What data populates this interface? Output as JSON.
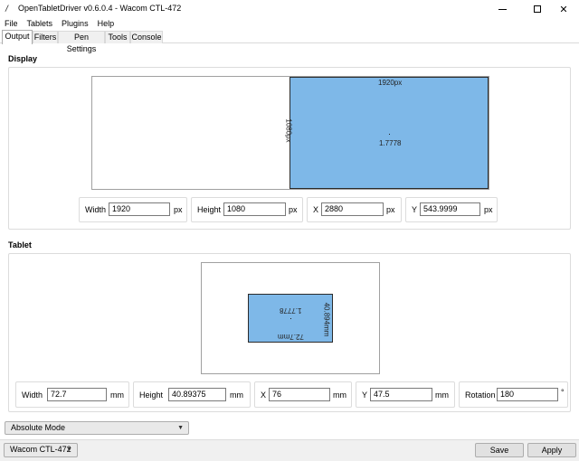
{
  "window": {
    "title": "OpenTabletDriver v0.6.0.4 - Wacom CTL-472"
  },
  "menu": [
    "File",
    "Tablets",
    "Plugins",
    "Help"
  ],
  "tabs": [
    "Output",
    "Filters",
    "Pen Settings",
    "Tools",
    "Console"
  ],
  "display": {
    "section_title": "Display",
    "area_width_label": "1920px",
    "area_height_label": "1080px",
    "aspect_label": "1.7778",
    "fields": {
      "width": {
        "label": "Width",
        "value": "1920",
        "unit": "px"
      },
      "height": {
        "label": "Height",
        "value": "1080",
        "unit": "px"
      },
      "x": {
        "label": "X",
        "value": "2880",
        "unit": "px"
      },
      "y": {
        "label": "Y",
        "value": "543.9999",
        "unit": "px"
      }
    }
  },
  "tablet": {
    "section_title": "Tablet",
    "area_width_label": "72.7mm",
    "area_height_label": "40.894mm",
    "aspect_label": "1.7778",
    "fields": {
      "width": {
        "label": "Width",
        "value": "72.7",
        "unit": "mm"
      },
      "height": {
        "label": "Height",
        "value": "40.89375",
        "unit": "mm"
      },
      "x": {
        "label": "X",
        "value": "76",
        "unit": "mm"
      },
      "y": {
        "label": "Y",
        "value": "47.5",
        "unit": "mm"
      },
      "rotation": {
        "label": "Rotation",
        "value": "180",
        "unit": "°"
      }
    }
  },
  "mode": {
    "selected": "Absolute Mode"
  },
  "footer": {
    "tablet_selected": "Wacom CTL-472",
    "save_label": "Save",
    "apply_label": "Apply"
  },
  "colors": {
    "area_fill": "#7eb8e8",
    "area_border": "#2b2b2b"
  }
}
